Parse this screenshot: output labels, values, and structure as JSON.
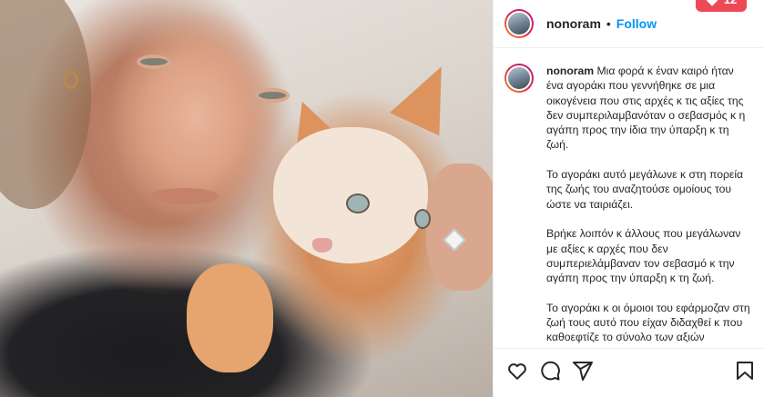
{
  "post": {
    "username": "nonoram",
    "follow_label": "Follow",
    "separator": "•",
    "notification_count": "12"
  },
  "caption": {
    "username": "nonoram",
    "paragraphs": [
      "Μια φορά κ έναν καιρό ήταν ένα αγοράκι που γεννήθηκε σε μια οικογένεια που στις αρχές κ τις αξίες της δεν συμπεριλαμβανόταν ο σεβασμός κ η αγάπη προς την ίδια την ύπαρξη κ τη ζωή.",
      "Το αγοράκι αυτό μεγάλωνε κ στη πορεία της ζωής του αναζητούσε ομοίους του ώστε να ταιριάζει.",
      "Βρήκε λοιπόν κ άλλους που μεγάλωναν με αξίες κ αρχές που δεν συμπεριελάμβαναν τον σεβασμό κ την αγάπη προς την ύπαρξη κ τη ζωή.",
      "Το αγοράκι κ οι όμοιοι του εφάρμοζαν στη ζωή τους αυτό που είχαν διδαχθεί κ που καθοεφτίζε το σύνολο των αξιών"
    ]
  },
  "icons": {
    "like": "heart-icon",
    "comment": "comment-icon",
    "share": "send-icon",
    "save": "bookmark-icon"
  },
  "colors": {
    "link": "#0095f6",
    "badge": "#ed4956",
    "text": "#262626",
    "divider": "#efefef"
  }
}
